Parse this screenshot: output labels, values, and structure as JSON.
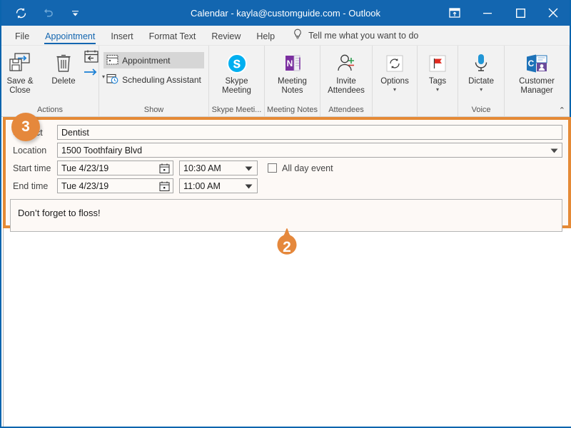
{
  "window": {
    "title": "Calendar - kayla@customguide.com - Outlook",
    "accent_color": "#1366b0",
    "highlight_color": "#e58a36"
  },
  "quick_access": [
    {
      "name": "sync-icon",
      "label": "Sync"
    },
    {
      "name": "undo-icon",
      "label": "Undo"
    },
    {
      "name": "customize-quick-access-icon",
      "label": "Customize Quick Access Toolbar"
    }
  ],
  "window_controls": [
    {
      "name": "ribbon-display-options",
      "label": "Ribbon Display Options"
    },
    {
      "name": "minimize",
      "label": "Minimize"
    },
    {
      "name": "maximize",
      "label": "Maximize"
    },
    {
      "name": "close",
      "label": "Close"
    }
  ],
  "ribbon": {
    "tabs": [
      {
        "label": "File",
        "active": false
      },
      {
        "label": "Appointment",
        "active": true
      },
      {
        "label": "Insert",
        "active": false
      },
      {
        "label": "Format Text",
        "active": false
      },
      {
        "label": "Review",
        "active": false
      },
      {
        "label": "Help",
        "active": false
      }
    ],
    "tell_me": "Tell me what you want to do",
    "collapse_label": "⌃",
    "groups": {
      "actions": {
        "label": "Actions",
        "save_close": "Save & Close",
        "delete": "Delete",
        "forward": "Forward"
      },
      "show": {
        "label": "Show",
        "appointment": "Appointment",
        "scheduling_assistant": "Scheduling Assistant"
      },
      "skype": {
        "label": "Skype Meeti...",
        "button": "Skype Meeting"
      },
      "meeting_notes": {
        "label": "Meeting Notes",
        "button": "Meeting Notes"
      },
      "attendees": {
        "label": "Attendees",
        "button": "Invite Attendees"
      },
      "options": {
        "label": "",
        "button": "Options"
      },
      "tags": {
        "label": "",
        "button": "Tags"
      },
      "voice": {
        "label": "Voice",
        "button": "Dictate"
      },
      "customer_manager": {
        "label": "",
        "button": "Customer Manager"
      }
    }
  },
  "form": {
    "subject": {
      "label": "Subject",
      "value": "Dentist",
      "placeholder": ""
    },
    "location": {
      "label": "Location",
      "value": "1500 Toothfairy Blvd",
      "placeholder": ""
    },
    "start_time": {
      "label": "Start time",
      "date": "Tue 4/23/19",
      "time": "10:30 AM"
    },
    "end_time": {
      "label": "End time",
      "date": "Tue 4/23/19",
      "time": "11:00 AM"
    },
    "all_day": {
      "label": "All day event",
      "checked": false
    },
    "body": "Don’t forget to floss!"
  },
  "callouts": [
    {
      "number": "2",
      "shape": "pin"
    },
    {
      "number": "3",
      "shape": "circle"
    }
  ]
}
